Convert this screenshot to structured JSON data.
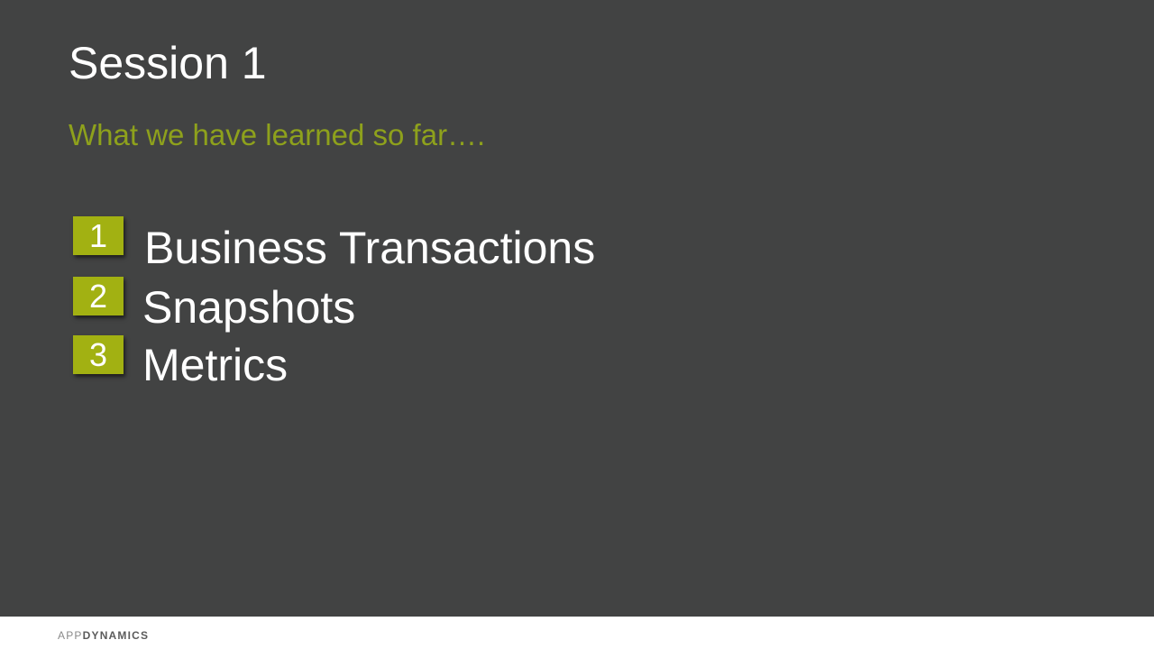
{
  "slide": {
    "title": "Session 1",
    "subtitle": "What we have learned so far….",
    "items": [
      {
        "number": "1",
        "label": "Business Transactions"
      },
      {
        "number": "2",
        "label": "Snapshots"
      },
      {
        "number": "3",
        "label": "Metrics"
      }
    ]
  },
  "footer": {
    "logo_part1": "APP",
    "logo_part2": "DYNAMICS"
  },
  "colors": {
    "background": "#424343",
    "accent": "#a2b112",
    "subtitle": "#8ea11c",
    "text": "#ffffff",
    "footer_background": "#ffffff"
  }
}
